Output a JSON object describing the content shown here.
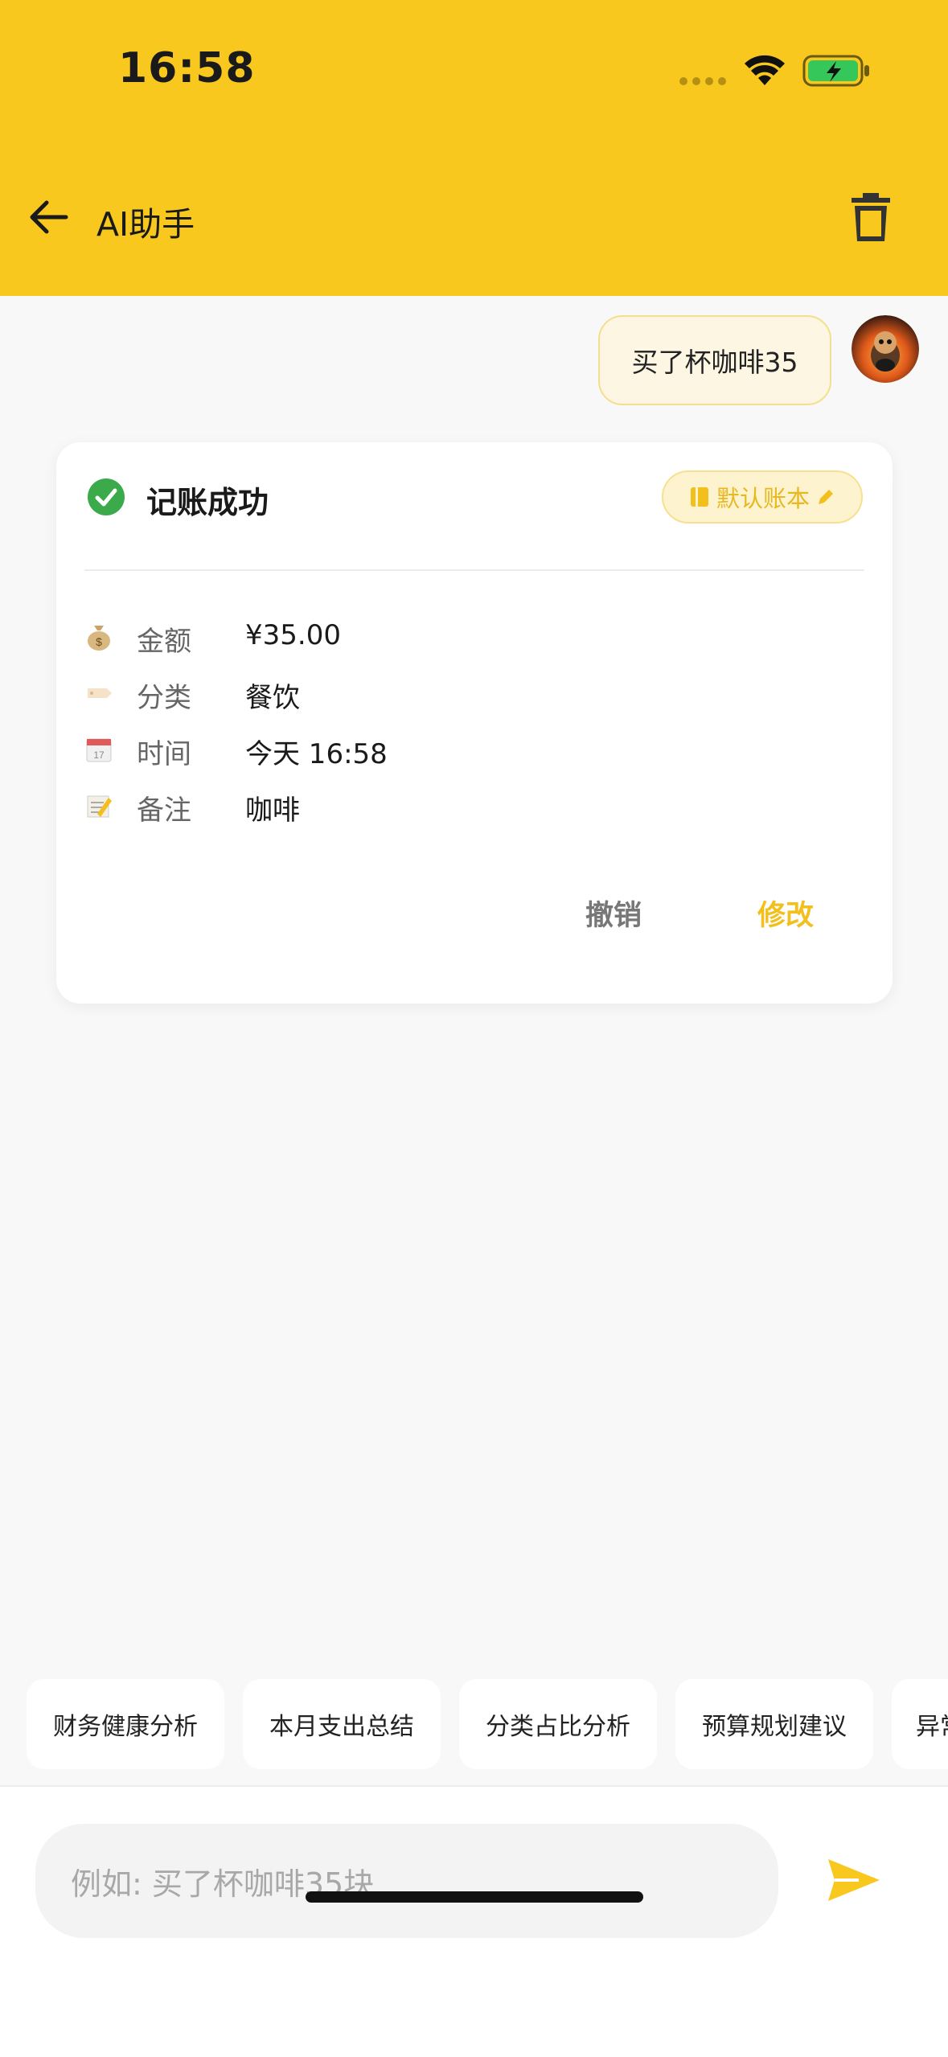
{
  "status_bar": {
    "time": "16:58"
  },
  "header": {
    "title": "AI助手"
  },
  "chat": {
    "user_message": "买了杯咖啡35",
    "card": {
      "title": "记账成功",
      "ledger": "默认账本",
      "rows": [
        {
          "icon": "money-bag-icon",
          "label": "金额",
          "value": "¥35.00"
        },
        {
          "icon": "tag-icon",
          "label": "分类",
          "value": "餐饮"
        },
        {
          "icon": "calendar-icon",
          "label": "时间",
          "value": "今天 16:58"
        },
        {
          "icon": "memo-icon",
          "label": "备注",
          "value": "咖啡"
        }
      ],
      "undo_label": "撤销",
      "modify_label": "修改"
    }
  },
  "quick_actions": [
    "财务健康分析",
    "本月支出总结",
    "分类占比分析",
    "预算规划建议",
    "异常"
  ],
  "input": {
    "placeholder": "例如: 买了杯咖啡35块"
  },
  "colors": {
    "accent": "#f8c81e",
    "success": "#3aaa4a",
    "modify": "#f2bf1c"
  }
}
